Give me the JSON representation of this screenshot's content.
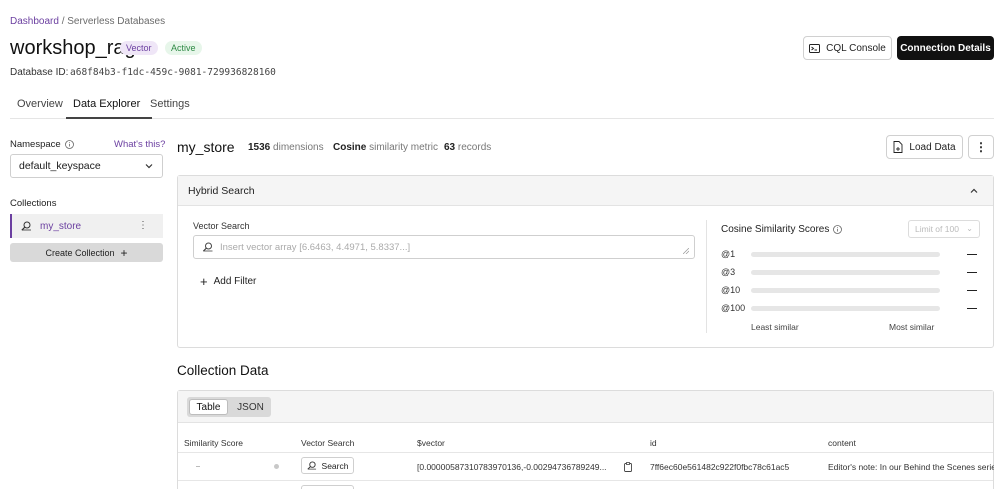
{
  "breadcrumb": {
    "root": "Dashboard",
    "separator": " / ",
    "current": "Serverless Databases"
  },
  "database": {
    "name": "workshop_rag",
    "badges": [
      "Vector",
      "Active"
    ],
    "id_label": "Database ID:",
    "id_value": "a68f84b3-f1dc-459c-9081-729936828160"
  },
  "header_buttons": {
    "cql_console": "CQL Console",
    "connection_details": "Connection Details"
  },
  "tabs": [
    {
      "label": "Overview",
      "active": false
    },
    {
      "label": "Data Explorer",
      "active": true
    },
    {
      "label": "Settings",
      "active": false
    }
  ],
  "sidebar": {
    "namespace_label": "Namespace",
    "whats_this": "What's this?",
    "namespace_value": "default_keyspace",
    "collections_label": "Collections",
    "collections": [
      {
        "name": "my_store",
        "icon": "vector-search-icon"
      }
    ],
    "create_collection": "Create Collection"
  },
  "collection": {
    "name": "my_store",
    "dimensions_value": "1536",
    "dimensions_label": "dimensions",
    "metric_value": "Cosine",
    "metric_label": "similarity metric",
    "records_value": "63",
    "records_label": "records",
    "load_data": "Load Data"
  },
  "hybrid_search": {
    "title": "Hybrid Search",
    "vector_search_label": "Vector Search",
    "vector_search_placeholder": "Insert vector array [6.6463, 4.4971, 5.8337...]",
    "add_filter": "Add Filter",
    "cosine_title": "Cosine Similarity Scores",
    "limit_placeholder": "Limit of 100",
    "scores": [
      {
        "label": "@1",
        "value": "—"
      },
      {
        "label": "@3",
        "value": "—"
      },
      {
        "label": "@10",
        "value": "—"
      },
      {
        "label": "@100",
        "value": "—"
      }
    ],
    "least_similar": "Least similar",
    "most_similar": "Most similar"
  },
  "collection_data": {
    "title": "Collection Data",
    "view_modes": [
      "Table",
      "JSON"
    ],
    "active_view": "Table",
    "columns": [
      "Similarity Score",
      "Vector Search",
      "$vector",
      "id",
      "content"
    ],
    "rows": [
      {
        "similarity": "–",
        "search_label": "Search",
        "vector": "[0.00000587310783970136,-0.00294736789249...",
        "id": "7ff6ec60e561482c922f0fbc78c61ac5",
        "content": "Editor's note: In our Behind the Scenes series"
      }
    ]
  },
  "colors": {
    "accent": "#6b3fa0",
    "primary_button": "#111111",
    "active_badge": "#2f8a45"
  }
}
